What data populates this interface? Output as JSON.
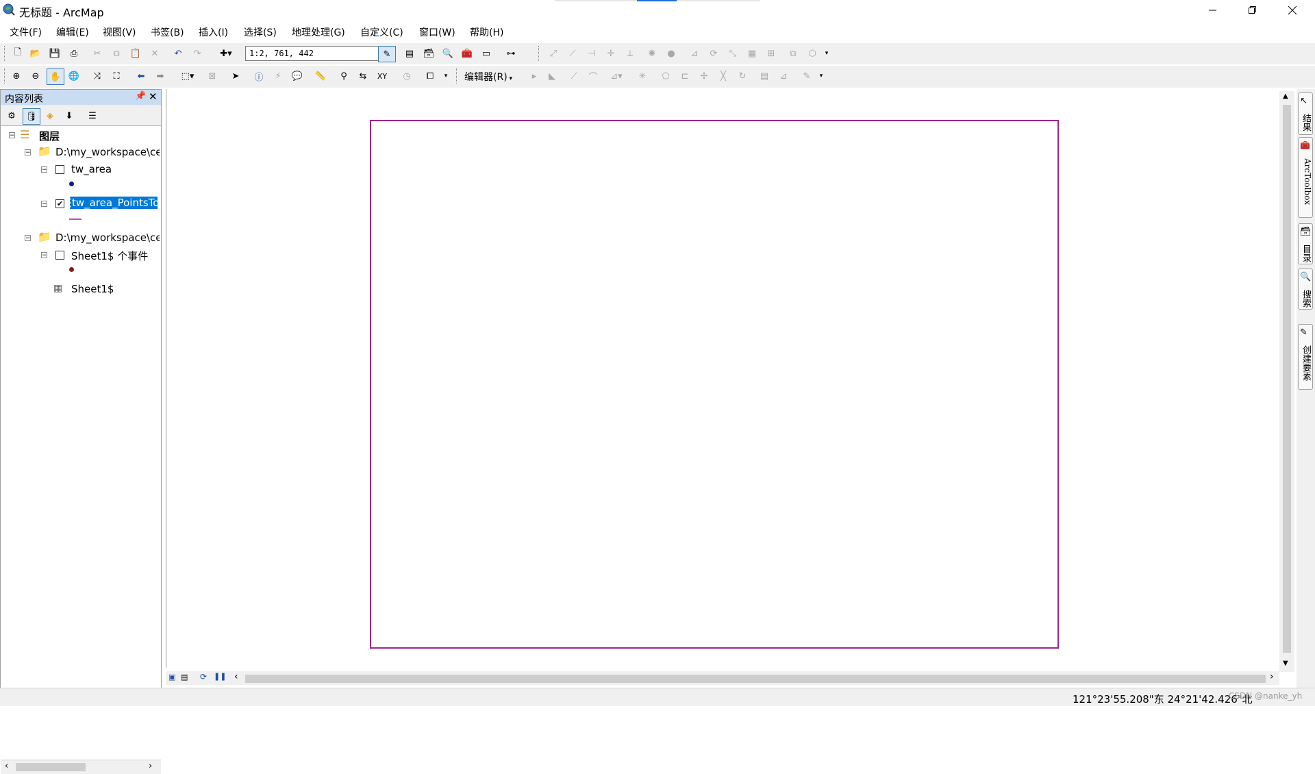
{
  "window": {
    "title": "无标题 - ArcMap",
    "minimize_icon": "minimize-icon",
    "maximize_icon": "restore-icon",
    "close_icon": "close-icon"
  },
  "menu": [
    "文件(F)",
    "编辑(E)",
    "视图(V)",
    "书签(B)",
    "插入(I)",
    "选择(S)",
    "地理处理(G)",
    "自定义(C)",
    "窗口(W)",
    "帮助(H)"
  ],
  "toolbar": {
    "scale": "1:2, 761, 442",
    "editor_label": "编辑器(R)"
  },
  "toc": {
    "title": "内容列表",
    "pin_icon": "pin-icon",
    "close_icon": "close-icon",
    "root": "图层",
    "groups": [
      {
        "path": "D:\\my_workspace\\ce",
        "layers": [
          {
            "name": "tw_area",
            "checked": false,
            "symbol": "point",
            "symbol_color": "#1a1a7a"
          },
          {
            "name": "tw_area_PointsTo",
            "checked": true,
            "symbol": "line",
            "symbol_color": "#c04ab0",
            "selected": true
          }
        ]
      },
      {
        "path": "D:\\my_workspace\\ce",
        "layers": [
          {
            "name": "Sheet1$ 个事件",
            "checked": false,
            "symbol": "point",
            "symbol_color": "#8a1a1a"
          },
          {
            "name": "Sheet1$",
            "symbol": "table"
          }
        ]
      }
    ]
  },
  "right_dock": [
    "结果",
    "ArcToolbox",
    "目录",
    "搜索",
    "创建要素"
  ],
  "status": {
    "coordinates": "121°23'55.208\"东  24°21'42.426\"北",
    "watermark": "CSDN @nanke_yh"
  },
  "colors": {
    "data_frame_border": "#a0248c",
    "selection": "#0078d7",
    "toc_header": "#c9dcf2"
  }
}
